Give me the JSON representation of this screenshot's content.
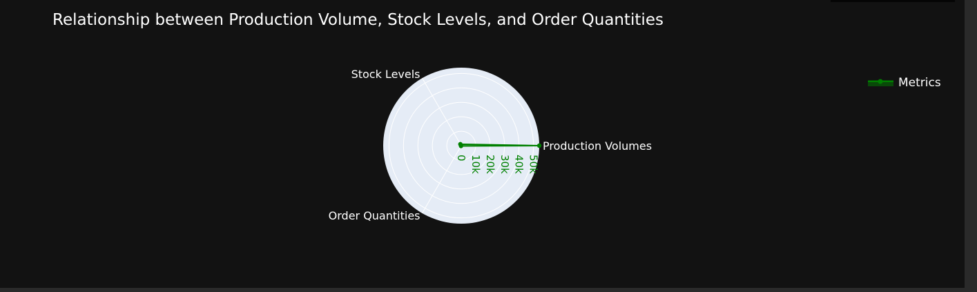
{
  "chart_data": {
    "type": "radar",
    "title": "Relationship between Production Volume, Stock Levels, and Order Quantities",
    "axes": [
      "Production Volumes",
      "Stock Levels",
      "Order Quantities"
    ],
    "series": [
      {
        "name": "Metrics",
        "values": [
          54000,
          1200,
          300
        ]
      }
    ],
    "radial_ticks": [
      "0",
      "10k",
      "20k",
      "30k",
      "40k",
      "50k"
    ],
    "radial_tick_values": [
      0,
      10000,
      20000,
      30000,
      40000,
      50000
    ],
    "radial_range": [
      0,
      54000
    ],
    "legend_position": "top-right",
    "colors": {
      "series": "#008000",
      "fill": "rgba(0,128,0,0.5)",
      "plot_bg": "#e5ecf6",
      "grid": "#ffffff",
      "tick_label": "#008000",
      "text": "#ffffff",
      "page_bg": "#121212"
    }
  }
}
